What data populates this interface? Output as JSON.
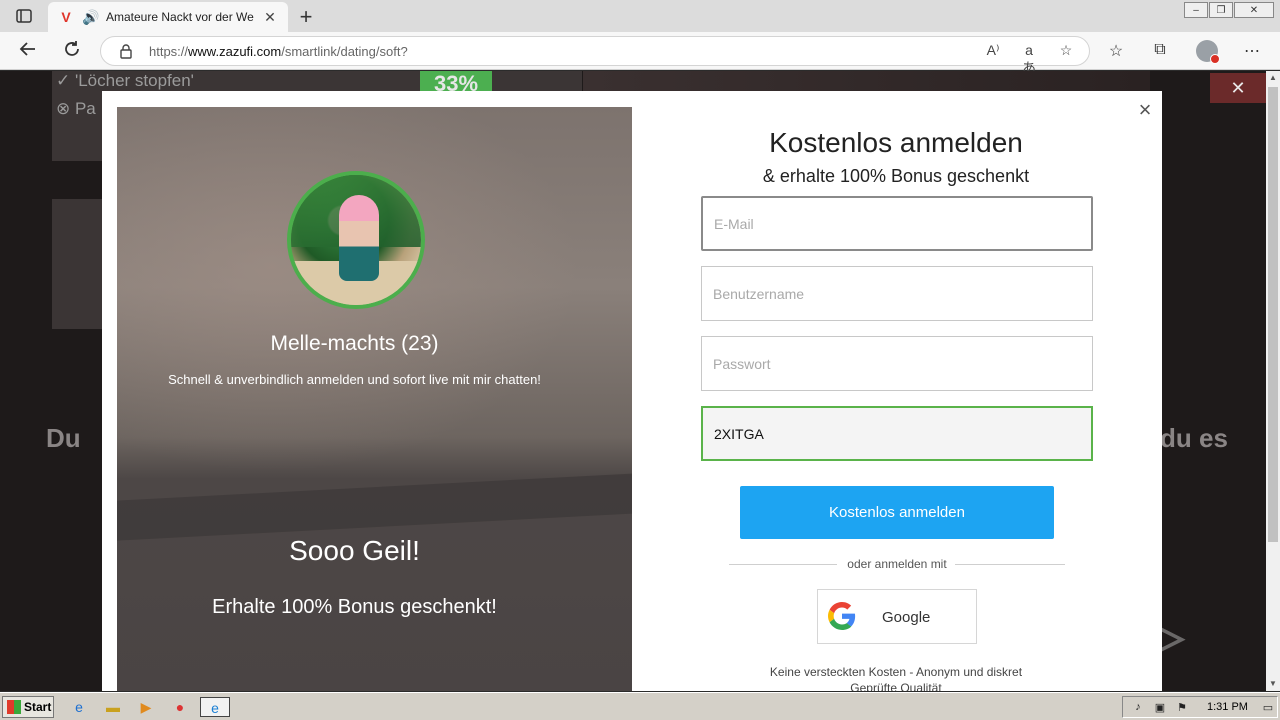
{
  "browser": {
    "tab_title": "Amateure Nackt vor der Webcam",
    "new_tab": "+",
    "url_prefix": "https://",
    "url_host": "www.zazufi.com",
    "url_path": "/smartlink/dating/soft?",
    "window_min": "–",
    "window_max": "❐",
    "window_close": "✕",
    "read_aloud": "A⁾",
    "translate": "aあ"
  },
  "background": {
    "check_text": "✓ 'Löcher stopfen'",
    "x_text": "⊗ Pa",
    "percent": "33%",
    "left_text": "Du",
    "right_text": "du es",
    "close": "✕",
    "watermark": "ANY ▷ RUN"
  },
  "modal": {
    "profile_name": "Melle-machts",
    "profile_age": "(23)",
    "tagline": "Schnell & unverbindlich anmelden und sofort live mit mir chatten!",
    "headline": "Sooo Geil!",
    "bonus": "Erhalte 100% Bonus geschenkt!",
    "close": "×",
    "form_title": "Kostenlos anmelden",
    "form_subtitle": "& erhalte 100% Bonus geschenkt",
    "email_placeholder": "E-Mail",
    "username_placeholder": "Benutzername",
    "password_placeholder": "Passwort",
    "code_value": "2XITGA",
    "submit_label": "Kostenlos anmelden",
    "or_text": "oder anmelden mit",
    "google_label": "Google",
    "footer_line1": "Keine versteckten Kosten - Anonym und diskret",
    "footer_line2": "Geprüfte Qualität"
  },
  "taskbar": {
    "start_label": "Start",
    "clock": "1:31 PM"
  },
  "colors": {
    "submit": "#1da4f2",
    "code_border": "#5ab34a",
    "avatar_ring": "#4cae4c"
  }
}
